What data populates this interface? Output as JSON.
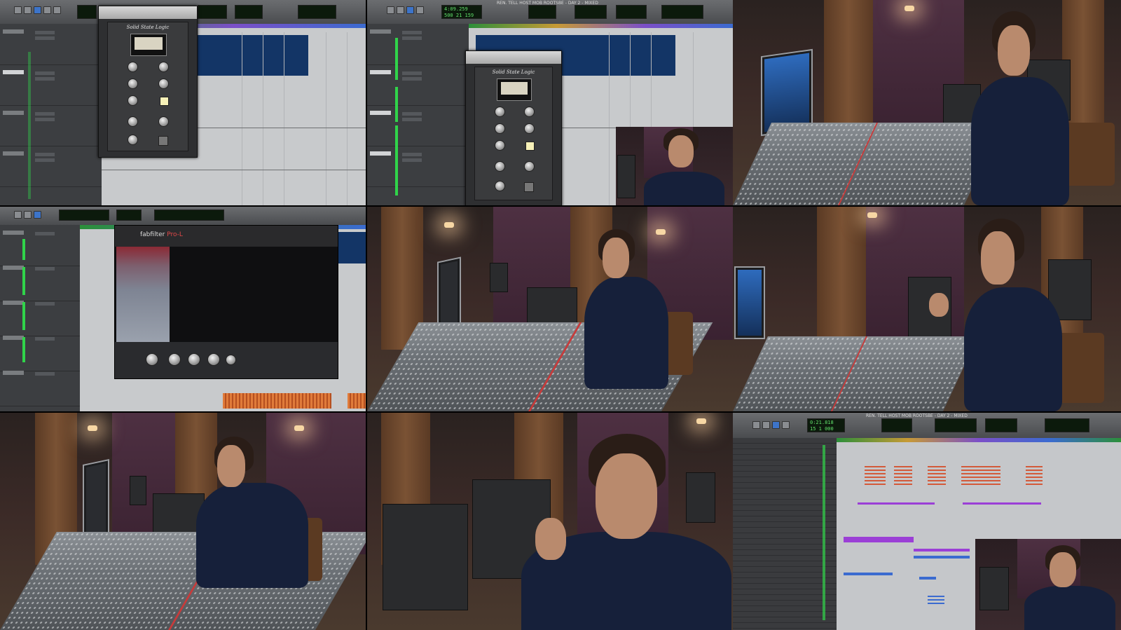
{
  "layout": "3x3 grid of video frames (Pro Tools sessions and studio interview shots)",
  "colors": {
    "counter_green": "#61e06b",
    "region_blue": "#133566",
    "midi_purple": "#9b3fd6",
    "midi_orange": "#e07b3a",
    "meter_green": "#30d44a"
  },
  "cells": {
    "c1": {
      "window_title": "",
      "plugin_title": "Solid State Logic"
    },
    "c2": {
      "window_title": "REN. TELL HOST MOB ROOTSBE - DAY 2 - MIXED",
      "counter_main": "4:09.259",
      "counter_sub": "500 21 159",
      "plugin_title": "Solid State Logic"
    },
    "c3": {
      "scene": "studio-interview"
    },
    "c4": {
      "plugin_brand": "fabfilter",
      "plugin_model": "Pro-L"
    },
    "c5": {
      "scene": "studio-interview"
    },
    "c6": {
      "scene": "studio-interview"
    },
    "c7": {
      "scene": "studio-interview"
    },
    "c8": {
      "scene": "studio-closeup"
    },
    "c9": {
      "window_title": "REN. TELL HOST MOB ROOTSBE - DAY 2 - MIXED",
      "counter_main": "0:21.818",
      "counter_sub": "15 1 000"
    }
  }
}
